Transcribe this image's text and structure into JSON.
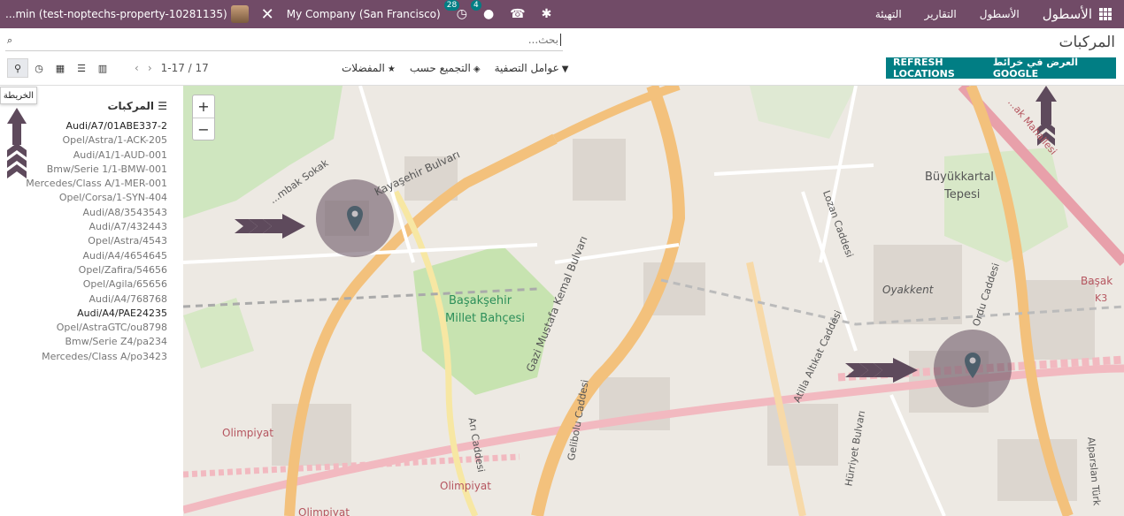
{
  "navbar": {
    "user": "...min (test-noptechs-property-10281135)",
    "company": "My Company (San Francisco)",
    "activity_count": "28",
    "message_count": "4",
    "brand": "الأسطول",
    "menu": [
      "الأسطول",
      "التقارير",
      "التهيئة"
    ]
  },
  "control": {
    "breadcrumb": "المركبات",
    "search_placeholder": "بحث...",
    "pager": "1-17 / 17",
    "filters_label": "عوامل التصفية",
    "group_by_label": "التجميع حسب",
    "favorites_label": "المفضلات",
    "google_maps_label": "العرض في خرائط GOOGLE",
    "refresh_label": "REFRESH LOCATIONS",
    "tooltip": "الخريطة"
  },
  "sidebar": {
    "title": "المركبات",
    "vehicles": [
      "Audi/A7/01ABE337-2",
      "Opel/Astra/1-ACK-205",
      "Audi/A1/1-AUD-001",
      "Bmw/Serie 1/1-BMW-001",
      "Mercedes/Class A/1-MER-001",
      "Opel/Corsa/1-SYN-404",
      "Audi/A8/3543543",
      "Audi/A7/432443",
      "Opel/Astra/4543",
      "Audi/A4/4654645",
      "Opel/Zafira/54656",
      "Opel/Agila/65656",
      "Audi/A4/768768",
      "Audi/A4/PAE24235",
      "Opel/AstraGTC/ou8798",
      "Bmw/Serie Z4/pa234",
      "Mercedes/Class A/po3423"
    ]
  },
  "map": {
    "labels": {
      "kayasehir": "Kayaşehir Bulvarı",
      "sokak": "...mbak Sokak",
      "millet1": "Başakşehir",
      "millet2": "Millet Bahçesi",
      "kemal": "Gazi Mustafa Kemal Bulvarı",
      "lozan": "Lozan Caddesi",
      "buyuk1": "Büyükkartal",
      "buyuk2": "Tepesi",
      "oyakkent": "Oyakkent",
      "ordu": "Ordu Caddesi",
      "altikat": "Atilla Altıkat Caddesi",
      "olimpiyat1": "Olimpiyat",
      "olimpiyat2": "Olimpiyat",
      "olimpiyat3": "Olimpiyat",
      "ari": "Arı Caddesi",
      "gelibolu": "Gelibolu Caddesi",
      "hurriyet": "Hürriyet Bulvarı",
      "alparslan": "Alparslan Türk",
      "mahallesi": "...ak Mahallesi",
      "basaksehir_r": "Başak",
      "k3": "K3"
    }
  }
}
